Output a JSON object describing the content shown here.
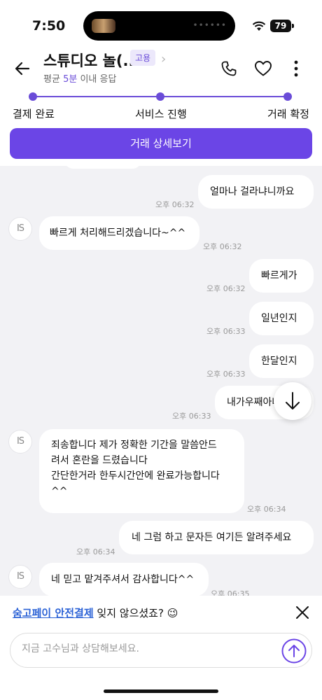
{
  "status_bar": {
    "time": "7:50",
    "battery": "79"
  },
  "header": {
    "title": "스튜디오 놀(...",
    "badge": "고용",
    "subtitle_prefix": "평균",
    "subtitle_highlight": "5분",
    "subtitle_suffix": "이내 응답"
  },
  "progress": {
    "steps": [
      "결제 완료",
      "서비스 진행",
      "거래 확정"
    ]
  },
  "detail_button": "거래 상세보기",
  "avatar_text": "IS",
  "messages": [
    {
      "side": "right",
      "text": "얼마나 걸라냐니까요",
      "time": "오후 06:32"
    },
    {
      "side": "left",
      "text": "빠르게 처리해드리겠습니다~^^",
      "time": "오후 06:32"
    },
    {
      "side": "right",
      "text": "빠르게가",
      "time": "오후 06:32"
    },
    {
      "side": "right",
      "text": "일년인지",
      "time": "오후 06:33"
    },
    {
      "side": "right",
      "text": "한달인지",
      "time": "오후 06:33"
    },
    {
      "side": "right",
      "text": "내가우째아나요?",
      "time": "오후 06:33"
    },
    {
      "side": "left",
      "lines": [
        "죄송합니다 제가 정확한 기간을 말씀안드",
        "려서 혼란을 드렸습니다",
        "간단한거라 한두시간안에 완료가능합니다",
        "^^"
      ],
      "time": "오후 06:34"
    },
    {
      "side": "right",
      "text": "네 그럼 하고 문자든 여기든 알려주세요",
      "time": "오후 06:34"
    },
    {
      "side": "left",
      "text": "네 믿고 맡겨주셔서 감사합니다^^",
      "time": "오후 06:35"
    }
  ],
  "notice": {
    "link": "숨고페이 안전결제",
    "text": "잊지 않으셨죠?",
    "emoji": "😉"
  },
  "input": {
    "placeholder": "지금 고수님과 상담해보세요."
  },
  "colors": {
    "accent": "#6b45e6",
    "chat_bg": "#f2f2f5",
    "link": "#2b62d6"
  }
}
